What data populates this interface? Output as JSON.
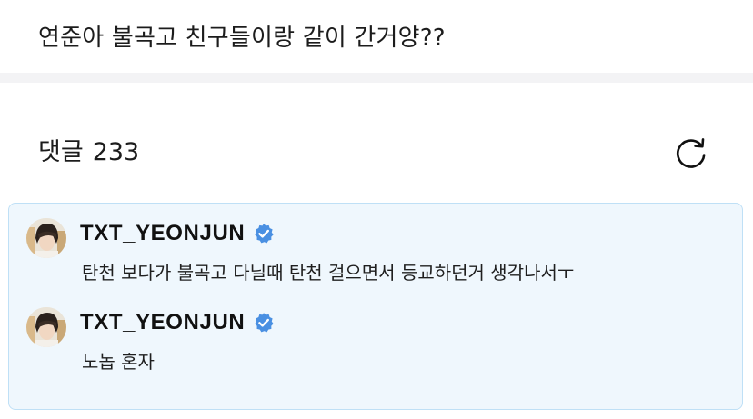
{
  "post": {
    "text": "연준아 불곡고 친구들이랑 같이 간거양??"
  },
  "comments_header": {
    "label": "댓글",
    "count": "233",
    "refresh_icon": "refresh-icon"
  },
  "replies": [
    {
      "author": "TXT_YEONJUN",
      "verified": true,
      "text": "탄천 보다가 불곡고 다닐때 탄천 걸으면서 등교하던거 생각나서ㅜ"
    },
    {
      "author": "TXT_YEONJUN",
      "verified": true,
      "text": "노놉 혼자"
    }
  ],
  "colors": {
    "reply_background": "#eff7fd",
    "reply_border": "#bfe0f6",
    "verified_badge": "#4a90e2",
    "separator": "#f3f3f5"
  }
}
